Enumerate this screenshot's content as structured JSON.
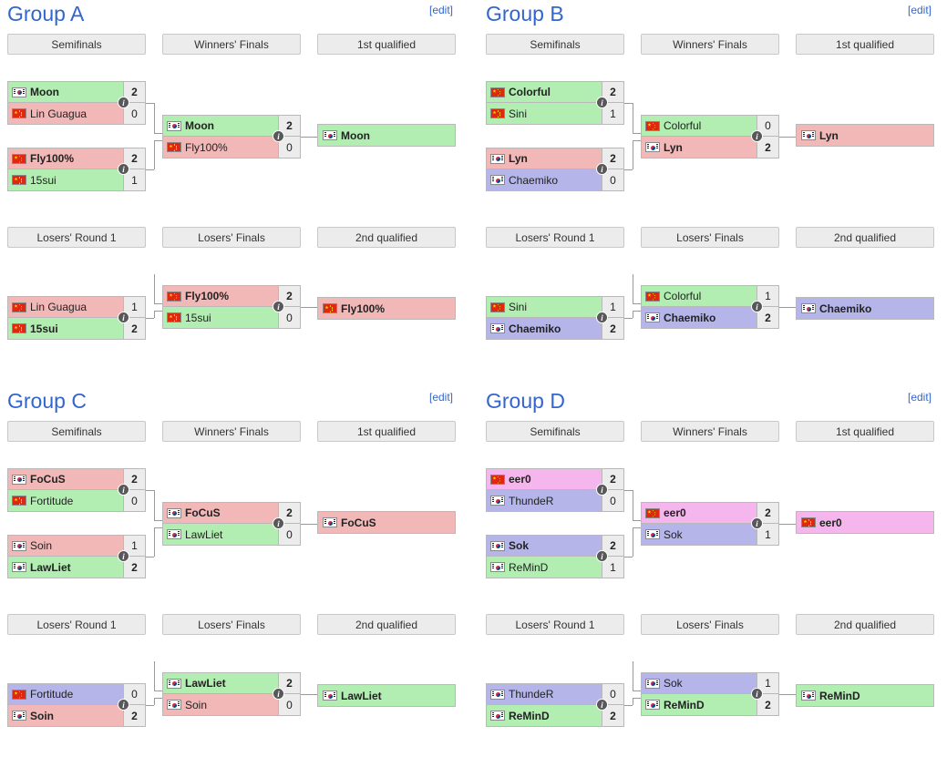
{
  "theme": {
    "title_color": "#3366cc",
    "link_color": "#3366cc",
    "header_bg": "#ececec",
    "header_border": "#c8c8c8",
    "win_green": "#b2eeb2",
    "loss_red": "#f2b8b8",
    "purple": "#b5b5ea",
    "pink": "#f5b6ee",
    "line_color": "#999999"
  },
  "edit_label": "[edit]",
  "info_icon": "info-icon",
  "round_labels": {
    "upper": [
      "Semifinals",
      "Winners' Finals",
      "1st qualified"
    ],
    "lower": [
      "Losers' Round 1",
      "Losers' Finals",
      "2nd qualified"
    ]
  },
  "groups": [
    {
      "id": "group-a",
      "title": "Group A",
      "upper": {
        "semifinals": [
          {
            "id": "a-sf1",
            "players": [
              {
                "name": "Moon",
                "flag": "kr",
                "score": "2",
                "winner": true,
                "color": "green"
              },
              {
                "name": "Lin Guagua",
                "flag": "cn",
                "score": "0",
                "winner": false,
                "color": "red"
              }
            ]
          },
          {
            "id": "a-sf2",
            "players": [
              {
                "name": "Fly100%",
                "flag": "cn",
                "score": "2",
                "winner": true,
                "color": "red"
              },
              {
                "name": "15sui",
                "flag": "cn",
                "score": "1",
                "winner": false,
                "color": "green"
              }
            ]
          }
        ],
        "winners_finals": {
          "id": "a-wf",
          "players": [
            {
              "name": "Moon",
              "flag": "kr",
              "score": "2",
              "winner": true,
              "color": "green"
            },
            {
              "name": "Fly100%",
              "flag": "cn",
              "score": "0",
              "winner": false,
              "color": "red"
            }
          ]
        },
        "qualified": {
          "id": "a-q1",
          "name": "Moon",
          "flag": "kr",
          "color": "green"
        }
      },
      "lower": {
        "round1": [
          {
            "id": "a-lr1",
            "players": [
              {
                "name": "Lin Guagua",
                "flag": "cn",
                "score": "1",
                "winner": false,
                "color": "red"
              },
              {
                "name": "15sui",
                "flag": "cn",
                "score": "2",
                "winner": true,
                "color": "green"
              }
            ]
          }
        ],
        "losers_finals": {
          "id": "a-lf",
          "players": [
            {
              "name": "Fly100%",
              "flag": "cn",
              "score": "2",
              "winner": true,
              "color": "red"
            },
            {
              "name": "15sui",
              "flag": "cn",
              "score": "0",
              "winner": false,
              "color": "green"
            }
          ]
        },
        "qualified": {
          "id": "a-q2",
          "name": "Fly100%",
          "flag": "cn",
          "color": "red"
        }
      }
    },
    {
      "id": "group-b",
      "title": "Group B",
      "upper": {
        "semifinals": [
          {
            "id": "b-sf1",
            "players": [
              {
                "name": "Colorful",
                "flag": "cn",
                "score": "2",
                "winner": true,
                "color": "green"
              },
              {
                "name": "Sini",
                "flag": "cn",
                "score": "1",
                "winner": false,
                "color": "green"
              }
            ]
          },
          {
            "id": "b-sf2",
            "players": [
              {
                "name": "Lyn",
                "flag": "kr",
                "score": "2",
                "winner": true,
                "color": "red"
              },
              {
                "name": "Chaemiko",
                "flag": "kr",
                "score": "0",
                "winner": false,
                "color": "purple"
              }
            ]
          }
        ],
        "winners_finals": {
          "id": "b-wf",
          "players": [
            {
              "name": "Colorful",
              "flag": "cn",
              "score": "0",
              "winner": false,
              "color": "green"
            },
            {
              "name": "Lyn",
              "flag": "kr",
              "score": "2",
              "winner": true,
              "color": "red"
            }
          ]
        },
        "qualified": {
          "id": "b-q1",
          "name": "Lyn",
          "flag": "kr",
          "color": "red"
        }
      },
      "lower": {
        "round1": [
          {
            "id": "b-lr1",
            "players": [
              {
                "name": "Sini",
                "flag": "cn",
                "score": "1",
                "winner": false,
                "color": "green"
              },
              {
                "name": "Chaemiko",
                "flag": "kr",
                "score": "2",
                "winner": true,
                "color": "purple"
              }
            ]
          }
        ],
        "losers_finals": {
          "id": "b-lf",
          "players": [
            {
              "name": "Colorful",
              "flag": "cn",
              "score": "1",
              "winner": false,
              "color": "green"
            },
            {
              "name": "Chaemiko",
              "flag": "kr",
              "score": "2",
              "winner": true,
              "color": "purple"
            }
          ]
        },
        "qualified": {
          "id": "b-q2",
          "name": "Chaemiko",
          "flag": "kr",
          "color": "purple"
        }
      }
    },
    {
      "id": "group-c",
      "title": "Group C",
      "upper": {
        "semifinals": [
          {
            "id": "c-sf1",
            "players": [
              {
                "name": "FoCuS",
                "flag": "kr",
                "score": "2",
                "winner": true,
                "color": "red"
              },
              {
                "name": "Fortitude",
                "flag": "cn",
                "score": "0",
                "winner": false,
                "color": "green"
              }
            ]
          },
          {
            "id": "c-sf2",
            "players": [
              {
                "name": "Soin",
                "flag": "kr",
                "score": "1",
                "winner": false,
                "color": "red"
              },
              {
                "name": "LawLiet",
                "flag": "kr",
                "score": "2",
                "winner": true,
                "color": "green"
              }
            ]
          }
        ],
        "winners_finals": {
          "id": "c-wf",
          "players": [
            {
              "name": "FoCuS",
              "flag": "kr",
              "score": "2",
              "winner": true,
              "color": "red"
            },
            {
              "name": "LawLiet",
              "flag": "kr",
              "score": "0",
              "winner": false,
              "color": "green"
            }
          ]
        },
        "qualified": {
          "id": "c-q1",
          "name": "FoCuS",
          "flag": "kr",
          "color": "red"
        }
      },
      "lower": {
        "round1": [
          {
            "id": "c-lr1",
            "players": [
              {
                "name": "Fortitude",
                "flag": "cn",
                "score": "0",
                "winner": false,
                "color": "purple"
              },
              {
                "name": "Soin",
                "flag": "kr",
                "score": "2",
                "winner": true,
                "color": "red"
              }
            ]
          }
        ],
        "losers_finals": {
          "id": "c-lf",
          "players": [
            {
              "name": "LawLiet",
              "flag": "kr",
              "score": "2",
              "winner": true,
              "color": "green"
            },
            {
              "name": "Soin",
              "flag": "kr",
              "score": "0",
              "winner": false,
              "color": "red"
            }
          ]
        },
        "qualified": {
          "id": "c-q2",
          "name": "LawLiet",
          "flag": "kr",
          "color": "green"
        }
      }
    },
    {
      "id": "group-d",
      "title": "Group D",
      "upper": {
        "semifinals": [
          {
            "id": "d-sf1",
            "players": [
              {
                "name": "eer0",
                "flag": "cn",
                "score": "2",
                "winner": true,
                "color": "pink"
              },
              {
                "name": "ThundeR",
                "flag": "kr",
                "score": "0",
                "winner": false,
                "color": "purple"
              }
            ]
          },
          {
            "id": "d-sf2",
            "players": [
              {
                "name": "Sok",
                "flag": "kr",
                "score": "2",
                "winner": true,
                "color": "purple"
              },
              {
                "name": "ReMinD",
                "flag": "kr",
                "score": "1",
                "winner": false,
                "color": "green"
              }
            ]
          }
        ],
        "winners_finals": {
          "id": "d-wf",
          "players": [
            {
              "name": "eer0",
              "flag": "cn",
              "score": "2",
              "winner": true,
              "color": "pink"
            },
            {
              "name": "Sok",
              "flag": "kr",
              "score": "1",
              "winner": false,
              "color": "purple"
            }
          ]
        },
        "qualified": {
          "id": "d-q1",
          "name": "eer0",
          "flag": "cn",
          "color": "pink"
        }
      },
      "lower": {
        "round1": [
          {
            "id": "d-lr1",
            "players": [
              {
                "name": "ThundeR",
                "flag": "kr",
                "score": "0",
                "winner": false,
                "color": "purple"
              },
              {
                "name": "ReMinD",
                "flag": "kr",
                "score": "2",
                "winner": true,
                "color": "green"
              }
            ]
          }
        ],
        "losers_finals": {
          "id": "d-lf",
          "players": [
            {
              "name": "Sok",
              "flag": "kr",
              "score": "1",
              "winner": false,
              "color": "purple"
            },
            {
              "name": "ReMinD",
              "flag": "kr",
              "score": "2",
              "winner": true,
              "color": "green"
            }
          ]
        },
        "qualified": {
          "id": "d-q2",
          "name": "ReMinD",
          "flag": "kr",
          "color": "green"
        }
      }
    }
  ]
}
